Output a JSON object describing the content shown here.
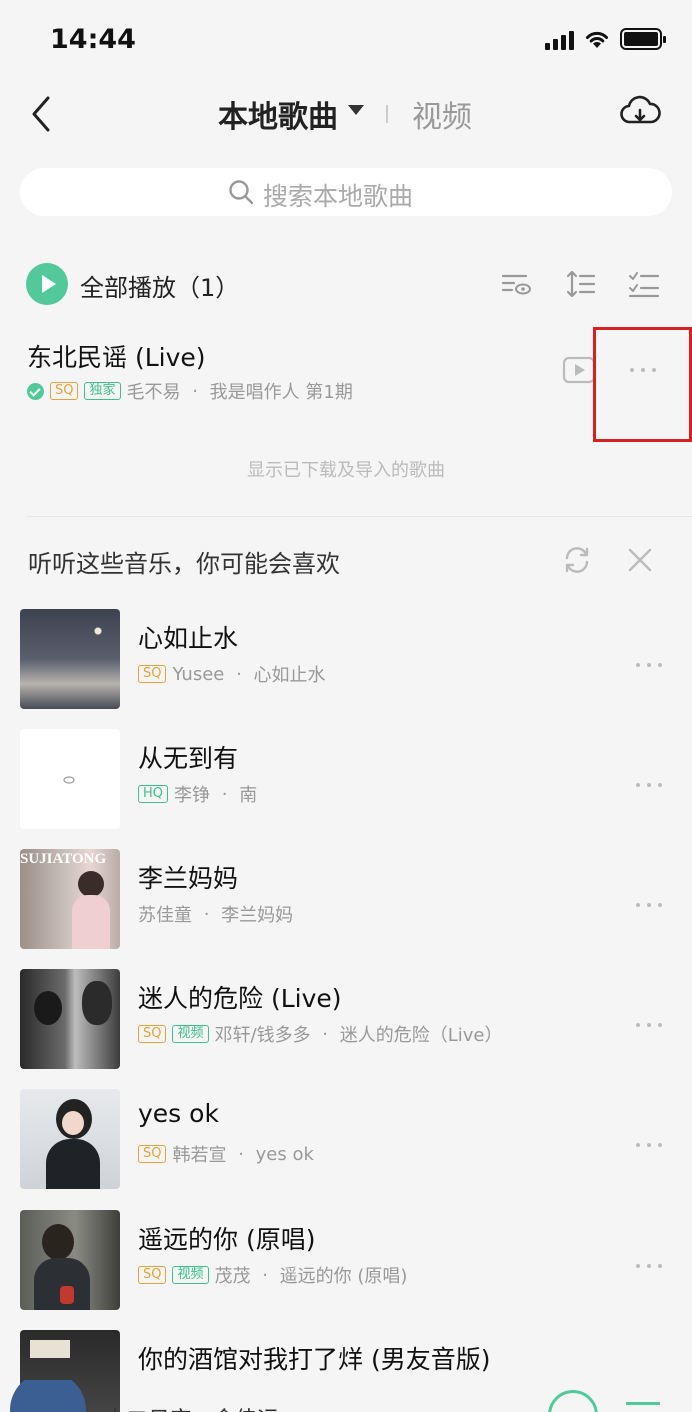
{
  "status_bar": {
    "time": "14:44"
  },
  "nav": {
    "title": "本地歌曲",
    "video_tab": "视频"
  },
  "search": {
    "placeholder": "搜索本地歌曲"
  },
  "play_all": {
    "label": "全部播放（1）"
  },
  "local_song": {
    "title": "东北民谣 (Live)",
    "badges": [
      "SQ",
      "独家"
    ],
    "artist": "毛不易",
    "album": "我是唱作人 第1期"
  },
  "hint": "显示已下载及导入的歌曲",
  "recommend": {
    "title": "听听这些音乐，你可能会喜欢",
    "items": [
      {
        "title": "心如止水",
        "badges": [
          "SQ"
        ],
        "artist": "Yusee",
        "album": "心如止水"
      },
      {
        "title": "从无到有",
        "badges": [
          "HQ"
        ],
        "artist": "李铮",
        "album": "南"
      },
      {
        "title": "李兰妈妈",
        "badges": [],
        "artist": "苏佳童",
        "album": "李兰妈妈",
        "cover_text": "SUJIATONG"
      },
      {
        "title": "迷人的危险 (Live)",
        "badges": [
          "SQ",
          "视频"
        ],
        "artist": "邓轩/钱多多",
        "album": "迷人的危险（Live）"
      },
      {
        "title": "yes ok",
        "badges": [
          "SQ"
        ],
        "artist": "韩若宣",
        "album": "yes ok"
      },
      {
        "title": "遥远的你 (原唱)",
        "badges": [
          "SQ",
          "视频"
        ],
        "artist": "茂茂",
        "album": "遥远的你 (原唱)"
      },
      {
        "title": "你的酒馆对我打了烊 (男友音版)",
        "badges": [],
        "artist": "",
        "album": ""
      }
    ]
  },
  "mini_player": {
    "text": "十二日宫 · 金佳运"
  },
  "colors": {
    "accent": "#52c89b",
    "sq_badge": "#e5a23b",
    "highlight": "#d82020"
  }
}
